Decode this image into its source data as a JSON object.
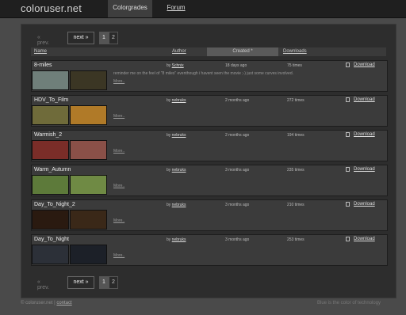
{
  "header": {
    "logo": "coloruser.net",
    "tabs": [
      {
        "label": "Colorgrades",
        "active": true
      },
      {
        "label": "Forum",
        "active": false
      }
    ]
  },
  "pager": {
    "prev": "« prev.",
    "next": "next »",
    "pages": [
      "1",
      "2"
    ]
  },
  "table": {
    "headers": {
      "name": "Name",
      "author": "Author",
      "created": "Created *",
      "downloads": "Downloads"
    },
    "download_label": "Download",
    "more_label": "More..",
    "rows": [
      {
        "name": "8-miles",
        "by": "by",
        "author": "Schnix",
        "date": "18 days ago",
        "times": "75 times",
        "desc": "reminder me on the feel of \"8 miles\" eventhough i havent seen the movie ;-) just some curves involved.",
        "thumbs": [
          "#6f7f7a",
          "#3b3624"
        ]
      },
      {
        "name": "HDV_To_Film",
        "by": "by",
        "author": "nebruks",
        "date": "2 months ago",
        "times": "272 times",
        "desc": "",
        "thumbs": [
          "#6f6b3a",
          "#b07a28"
        ]
      },
      {
        "name": "Warmish_2",
        "by": "by",
        "author": "nebruks",
        "date": "2 months ago",
        "times": "194 times",
        "desc": "",
        "thumbs": [
          "#7a2d28",
          "#8a5048"
        ]
      },
      {
        "name": "Warm_Autumn",
        "by": "by",
        "author": "nebruks",
        "date": "3 months ago",
        "times": "235 times",
        "desc": "",
        "thumbs": [
          "#5d7a3a",
          "#6f8a44"
        ]
      },
      {
        "name": "Day_To_Night_2",
        "by": "by",
        "author": "nebruks",
        "date": "3 months ago",
        "times": "210 times",
        "desc": "",
        "thumbs": [
          "#2a1a10",
          "#3a2818"
        ]
      },
      {
        "name": "Day_To_Night",
        "by": "by",
        "author": "nebruks",
        "date": "3 months ago",
        "times": "253 times",
        "desc": "",
        "thumbs": [
          "#2c3038",
          "#1c2028"
        ]
      }
    ]
  },
  "footer": {
    "copyright": "© coloruser.net |",
    "contact": "contact",
    "tagline": "Blue is the color of technology"
  }
}
